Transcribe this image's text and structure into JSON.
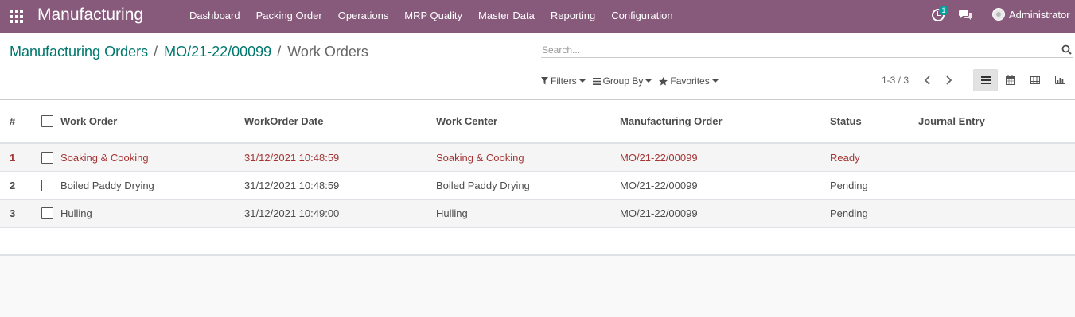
{
  "app": {
    "title": "Manufacturing"
  },
  "menu": [
    "Dashboard",
    "Packing Order",
    "Operations",
    "MRP Quality",
    "Master Data",
    "Reporting",
    "Configuration"
  ],
  "systray": {
    "activity_count": "1",
    "user_name": "Administrator"
  },
  "breadcrumb": {
    "root": "Manufacturing Orders",
    "order": "MO/21-22/00099",
    "current": "Work Orders",
    "separator": "/"
  },
  "search": {
    "placeholder": "Search...",
    "value": ""
  },
  "filters": {
    "filters_label": "Filters",
    "group_by_label": "Group By",
    "favorites_label": "Favorites"
  },
  "pager": {
    "text": "1-3 / 3"
  },
  "views": [
    "list-view",
    "calendar-view",
    "pivot-view",
    "graph-view"
  ],
  "table": {
    "columns": [
      "#",
      "Work Order",
      "WorkOrder Date",
      "Work Center",
      "Manufacturing Order",
      "Status",
      "Journal Entry"
    ],
    "rows": [
      {
        "num": "1",
        "work_order": "Soaking & Cooking",
        "date": "31/12/2021 10:48:59",
        "work_center": "Soaking & Cooking",
        "mo": "MO/21-22/00099",
        "status": "Ready",
        "journal": ""
      },
      {
        "num": "2",
        "work_order": "Boiled Paddy Drying",
        "date": "31/12/2021 10:48:59",
        "work_center": "Boiled Paddy Drying",
        "mo": "MO/21-22/00099",
        "status": "Pending",
        "journal": ""
      },
      {
        "num": "3",
        "work_order": "Hulling",
        "date": "31/12/2021 10:49:00",
        "work_center": "Hulling",
        "mo": "MO/21-22/00099",
        "status": "Pending",
        "journal": ""
      }
    ]
  },
  "colors": {
    "navbar": "#875a7b",
    "link": "#00776d",
    "ready_row": "#a33535",
    "badge": "#00a09d"
  }
}
